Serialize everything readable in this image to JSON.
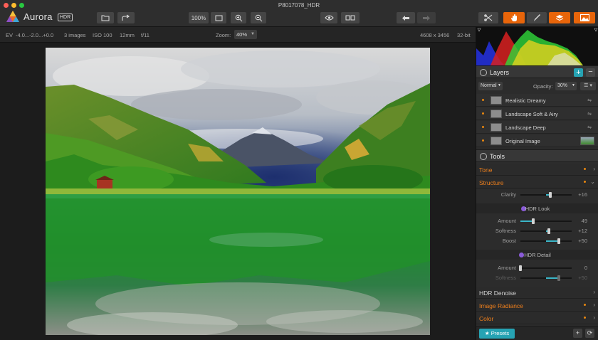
{
  "window": {
    "title": "P8017078_HDR"
  },
  "app": {
    "name": "Aurora",
    "badge": "HDR"
  },
  "toolbar": {
    "zoom_fit_label": "100%"
  },
  "infobar": {
    "ev_label": "EV",
    "ev_values": "-4.0...-2.0...+0.0",
    "images": "3 images",
    "iso": "ISO 100",
    "focal": "12mm",
    "aperture": "f/11",
    "zoom_label": "Zoom:",
    "zoom_value": "40%",
    "dimensions": "4608 x 3456",
    "bit_depth": "32-bit"
  },
  "layers": {
    "title": "Layers",
    "blend_mode": "Normal",
    "opacity_label": "Opacity:",
    "opacity_value": "30%",
    "items": [
      {
        "name": "Realistic Dreamy"
      },
      {
        "name": "Landscape Soft & Airy"
      },
      {
        "name": "Landscape Deep"
      },
      {
        "name": "Original Image"
      }
    ]
  },
  "tools": {
    "title": "Tools",
    "tone": "Tone",
    "structure": "Structure",
    "clarity": {
      "label": "Clarity",
      "value": "+16",
      "level": 0.58
    },
    "hdr_look": {
      "title": "HDR Look",
      "amount": {
        "label": "Amount",
        "value": "49",
        "level": 0.245
      },
      "softness": {
        "label": "Softness",
        "value": "+12",
        "level": 0.56
      },
      "boost": {
        "label": "Boost",
        "value": "+50",
        "level": 0.75
      }
    },
    "hdr_detail": {
      "title": "HDR Detail",
      "amount": {
        "label": "Amount",
        "value": "0",
        "level": 0.0
      },
      "softness": {
        "label": "Softness",
        "value": "+50",
        "level": 0.75
      }
    },
    "hdr_denoise": "HDR Denoise",
    "image_radiance": "Image Radiance",
    "color": "Color"
  },
  "bottom": {
    "presets": "Presets"
  },
  "colors": {
    "accent_orange": "#e8650a",
    "accent_teal": "#26a3b3",
    "category_orange": "#ee7f1c"
  }
}
